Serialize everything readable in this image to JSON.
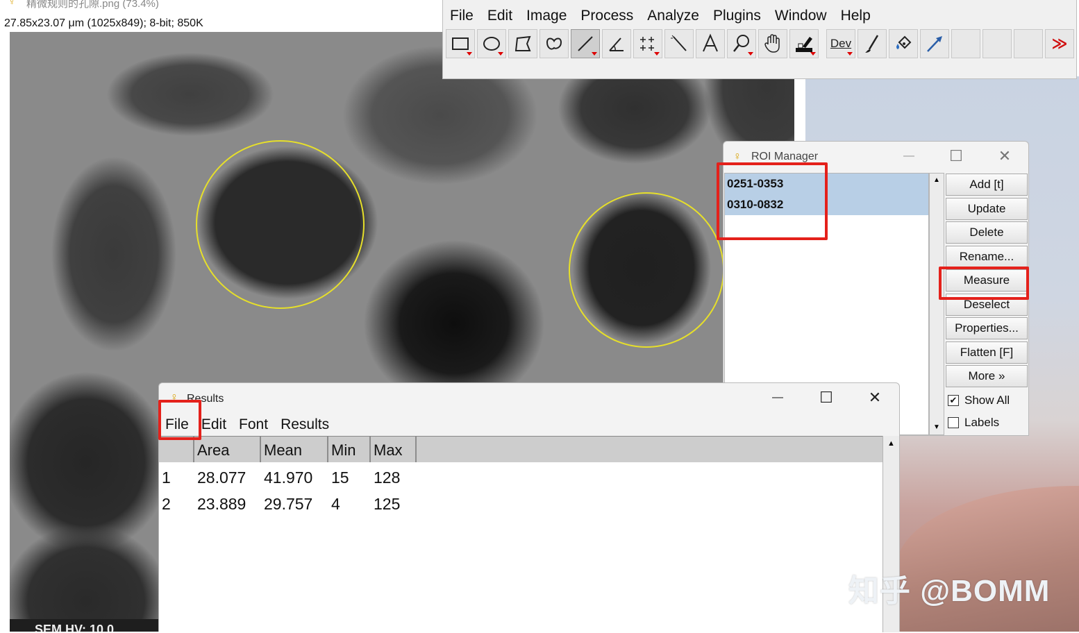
{
  "image_window": {
    "title": "精微规则的孔隙.png (73.4%)",
    "info": "27.85x23.07 μm (1025x849); 8-bit; 850K",
    "footer_text": "SEM HV: 10.0"
  },
  "imagej": {
    "menu": [
      "File",
      "Edit",
      "Image",
      "Process",
      "Analyze",
      "Plugins",
      "Window",
      "Help"
    ],
    "tools": [
      {
        "icon": "rectangle-tool-icon"
      },
      {
        "icon": "oval-tool-icon"
      },
      {
        "icon": "polygon-tool-icon"
      },
      {
        "icon": "freehand-tool-icon"
      },
      {
        "icon": "line-tool-icon"
      },
      {
        "icon": "angle-tool-icon"
      },
      {
        "icon": "multipoint-tool-icon"
      },
      {
        "icon": "wand-tool-icon"
      },
      {
        "icon": "text-tool-icon"
      },
      {
        "icon": "magnifier-tool-icon"
      },
      {
        "icon": "hand-tool-icon"
      },
      {
        "icon": "color-picker-tool-icon"
      },
      {
        "icon": "dev-tool-icon",
        "label": "Dev"
      },
      {
        "icon": "brush-tool-icon"
      },
      {
        "icon": "flood-fill-tool-icon"
      },
      {
        "icon": "arrow-tool-icon"
      },
      {
        "icon": "empty-slot-icon"
      },
      {
        "icon": "empty-slot-icon"
      },
      {
        "icon": "empty-slot-icon"
      },
      {
        "icon": "more-tools-icon",
        "label": "≫"
      }
    ]
  },
  "roi_manager": {
    "title": "ROI Manager",
    "items": [
      "0251-0353",
      "0310-0832"
    ],
    "buttons": [
      "Add [t]",
      "Update",
      "Delete",
      "Rename...",
      "Measure",
      "Deselect",
      "Properties...",
      "Flatten [F]",
      "More »"
    ],
    "show_all": {
      "label": "Show All",
      "checked": true
    },
    "labels": {
      "label": "Labels",
      "checked": false
    }
  },
  "results": {
    "title": "Results",
    "menu": [
      "File",
      "Edit",
      "Font",
      "Results"
    ],
    "columns": [
      "",
      "Area",
      "Mean",
      "Min",
      "Max"
    ],
    "rows": [
      [
        "1",
        "28.077",
        "41.970",
        "15",
        "128"
      ],
      [
        "2",
        "23.889",
        "29.757",
        "4",
        "125"
      ]
    ]
  },
  "window_controls": {
    "minimize": "—",
    "maximize": "☐",
    "close": "✕"
  },
  "watermark": "知乎 @BOMM",
  "colors": {
    "highlight_red": "#e4211b",
    "roi_yellow": "#e6df2a",
    "selection_blue": "#b8cfe6"
  }
}
